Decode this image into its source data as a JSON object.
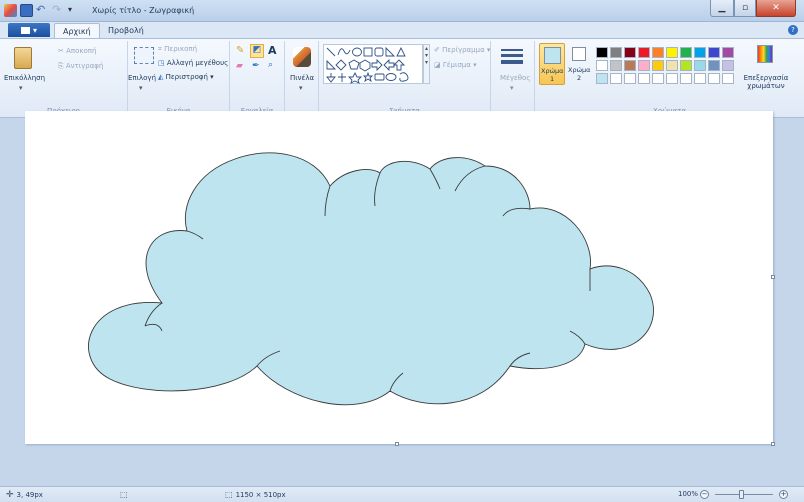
{
  "window": {
    "title": "Χωρίς τίτλο - Ζωγραφική"
  },
  "tabs": {
    "file_label": "▾",
    "home": "Αρχική",
    "view": "Προβολή"
  },
  "clipboard": {
    "paste": "Επικόλληση",
    "cut": "Αποκοπή",
    "copy": "Αντιγραφή",
    "group_label": "Πρόχειρο"
  },
  "image": {
    "select": "Επιλογή",
    "crop": "Περικοπή",
    "resize": "Αλλαγή μεγέθους",
    "rotate": "Περιστροφή",
    "group_label": "Εικόνα"
  },
  "tools": {
    "group_label": "Εργαλεία",
    "brushes": "Πινέλα"
  },
  "shapes": {
    "outline": "Περίγραμμα",
    "fill": "Γέμισμα",
    "group_label": "Σχήματα"
  },
  "size": {
    "label": "Μέγεθος"
  },
  "colors": {
    "color1": "Χρώμα",
    "color1_num": "1",
    "color2": "Χρώμα",
    "color2_num": "2",
    "edit_colors": "Επεξεργασία χρωμάτων",
    "group_label": "Χρώματα",
    "color1_value": "#bde4ef",
    "color2_value": "#ffffff",
    "palette_row1": [
      "#000000",
      "#7f7f7f",
      "#880015",
      "#ed1c24",
      "#ff7f27",
      "#fff200",
      "#22b14c",
      "#00a2e8",
      "#3f48cc",
      "#a349a4"
    ],
    "palette_row2": [
      "#ffffff",
      "#c3c3c3",
      "#b97a57",
      "#ffaec9",
      "#ffc90e",
      "#efe4b0",
      "#b5e61d",
      "#99d9ea",
      "#7092be",
      "#c8bfe7"
    ],
    "palette_row3": [
      "#bde4ef",
      "#ffffff",
      "#ffffff",
      "#ffffff",
      "#ffffff",
      "#ffffff",
      "#ffffff",
      "#ffffff",
      "#ffffff",
      "#ffffff"
    ]
  },
  "canvas": {
    "cloud_fill": "#bde4ef",
    "cloud_stroke": "#3a3a3a"
  },
  "status": {
    "cursor_pos": "3, 49px",
    "canvas_size": "1150 × 510px",
    "zoom": "100%"
  }
}
